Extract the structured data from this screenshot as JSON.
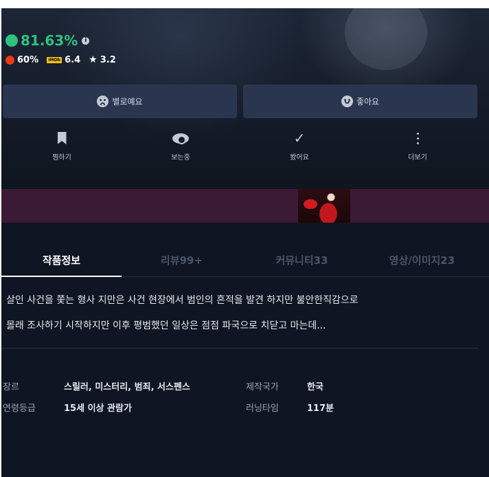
{
  "ratings": {
    "main_score": "81.63%",
    "tomato": "60%",
    "imdb_label": "IMDb",
    "imdb": "6.4",
    "star": "3.2",
    "colors": {
      "main": "#2ec27e",
      "tomato": "#f03a17",
      "imdb": "#f5c518"
    }
  },
  "reaction_buttons": {
    "dislike": "별로예요",
    "like": "좋아요"
  },
  "actions": {
    "bookmark": "찜하기",
    "watching": "보는중",
    "watched": "봤어요",
    "more": "더보기"
  },
  "tabs": [
    "작품정보",
    "리뷰99+",
    "커뮤니티33",
    "영상/이미지23"
  ],
  "description": {
    "line1": "살인 사건을 쫓는 형사 지만은 사건 현장에서 범인의 흔적을 발견 하지만 불안한직감으로",
    "line2": "몰래 조사하기 시작하지만 이후 평범했던 일상은 점점 파국으로 치닫고 마는데..."
  },
  "meta": {
    "genre_label": "장르",
    "genre": "스릴러, 미스터리, 범죄, 서스펜스",
    "country_label": "제작국가",
    "country": "한국",
    "rating_label": "연령등급",
    "rating": "15세 이상 관람가",
    "runtime_label": "러닝타임",
    "runtime": "117분"
  }
}
